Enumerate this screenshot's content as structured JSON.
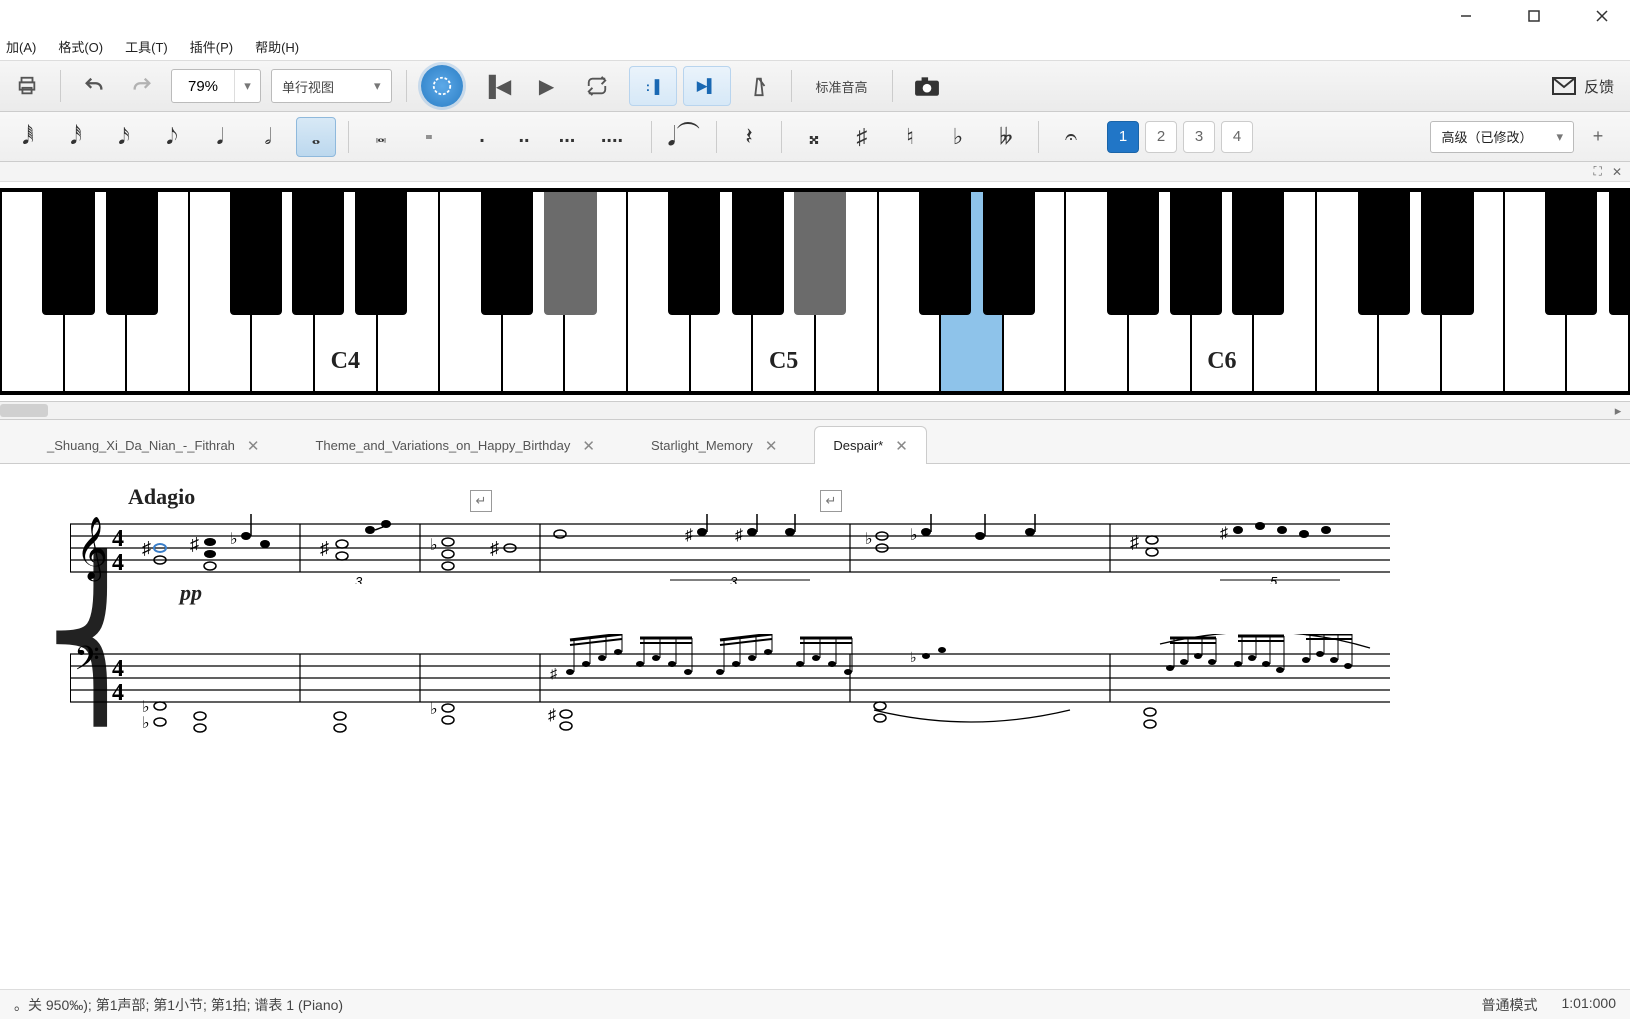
{
  "window": {
    "min": "—",
    "max": "❐",
    "close": "✕"
  },
  "menu": {
    "add": "加(A)",
    "format": "格式(O)",
    "tools": "工具(T)",
    "plugins": "插件(P)",
    "help": "帮助(H)"
  },
  "toolbar": {
    "zoom": "79%",
    "view_mode": "单行视图",
    "tuning": "标准音高",
    "feedback": "反馈"
  },
  "notebar": {
    "accidentals": {
      "dsharp": "𝄪",
      "sharp": "♯",
      "natural": "♮",
      "flat": "♭",
      "dflat": "𝄫"
    },
    "voices": [
      "1",
      "2",
      "3",
      "4"
    ],
    "workspace": "高级（已修改）"
  },
  "piano": {
    "labels": {
      "c4": "C4",
      "c5": "C5",
      "c6": "C6"
    }
  },
  "tabs": [
    {
      "label": "_Shuang_Xi_Da_Nian_-_Fithrah",
      "active": false
    },
    {
      "label": "Theme_and_Variations_on_Happy_Birthday",
      "active": false
    },
    {
      "label": "Starlight_Memory",
      "active": false
    },
    {
      "label": "Despair*",
      "active": true
    }
  ],
  "score": {
    "tempo": "Adagio",
    "dynamic": "pp",
    "time_sig_num": "4",
    "time_sig_den": "4"
  },
  "status": {
    "left": "。关 950‰); 第1声部; 第1小节; 第1拍; 谱表 1 (Piano)",
    "mode": "普通模式",
    "pos": "1:01:000"
  }
}
